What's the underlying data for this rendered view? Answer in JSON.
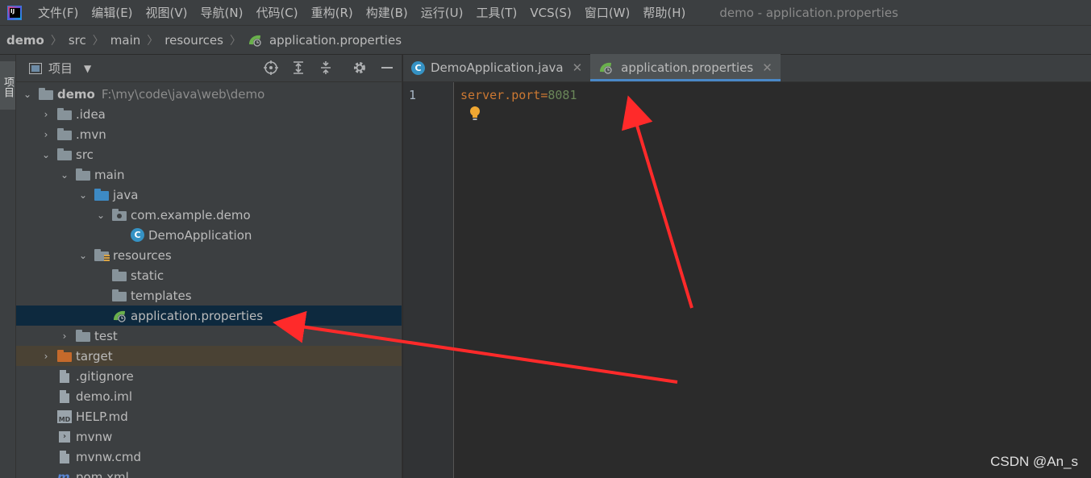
{
  "menubar": {
    "items": [
      "文件(F)",
      "编辑(E)",
      "视图(V)",
      "导航(N)",
      "代码(C)",
      "重构(R)",
      "构建(B)",
      "运行(U)",
      "工具(T)",
      "VCS(S)",
      "窗口(W)",
      "帮助(H)"
    ],
    "window_title": "demo - application.properties"
  },
  "breadcrumb": [
    "demo",
    "src",
    "main",
    "resources",
    "application.properties"
  ],
  "left_strip": {
    "tab_label": "项目"
  },
  "project_panel": {
    "title": "项目",
    "tree": [
      {
        "label": "demo",
        "path": "F:\\my\\code\\java\\web\\demo",
        "depth": 0,
        "expanded": true,
        "icon": "module-folder-icon"
      },
      {
        "label": ".idea",
        "depth": 1,
        "expanded": false,
        "icon": "folder-icon"
      },
      {
        "label": ".mvn",
        "depth": 1,
        "expanded": false,
        "icon": "folder-icon"
      },
      {
        "label": "src",
        "depth": 1,
        "expanded": true,
        "icon": "folder-icon"
      },
      {
        "label": "main",
        "depth": 2,
        "expanded": true,
        "icon": "folder-icon"
      },
      {
        "label": "java",
        "depth": 3,
        "expanded": true,
        "icon": "source-folder-icon"
      },
      {
        "label": "com.example.demo",
        "depth": 4,
        "expanded": true,
        "icon": "package-icon"
      },
      {
        "label": "DemoApplication",
        "depth": 5,
        "icon": "spring-class-icon"
      },
      {
        "label": "resources",
        "depth": 3,
        "expanded": true,
        "icon": "resources-folder-icon"
      },
      {
        "label": "static",
        "depth": 4,
        "icon": "folder-icon"
      },
      {
        "label": "templates",
        "depth": 4,
        "icon": "folder-icon"
      },
      {
        "label": "application.properties",
        "depth": 4,
        "icon": "spring-properties-icon",
        "selected": true
      },
      {
        "label": "test",
        "depth": 2,
        "expanded": false,
        "icon": "folder-icon"
      },
      {
        "label": "target",
        "depth": 1,
        "expanded": false,
        "icon": "excluded-folder-icon"
      },
      {
        "label": ".gitignore",
        "depth": 1,
        "icon": "file-icon"
      },
      {
        "label": "demo.iml",
        "depth": 1,
        "icon": "file-icon"
      },
      {
        "label": "HELP.md",
        "depth": 1,
        "icon": "markdown-icon"
      },
      {
        "label": "mvnw",
        "depth": 1,
        "icon": "terminal-icon"
      },
      {
        "label": "mvnw.cmd",
        "depth": 1,
        "icon": "file-icon"
      },
      {
        "label": "pom.xml",
        "depth": 1,
        "icon": "maven-icon"
      }
    ]
  },
  "editor": {
    "tabs": [
      {
        "label": "DemoApplication.java",
        "active": false
      },
      {
        "label": "application.properties",
        "active": true
      }
    ],
    "line_number": "1",
    "code": {
      "key": "server.port",
      "eq": "=",
      "value": "8081"
    }
  },
  "watermark": "CSDN @An_s",
  "colors": {
    "accent": "#4a88c7",
    "selection": "#0d293e",
    "annotation_arrow": "#ff2a2a"
  }
}
